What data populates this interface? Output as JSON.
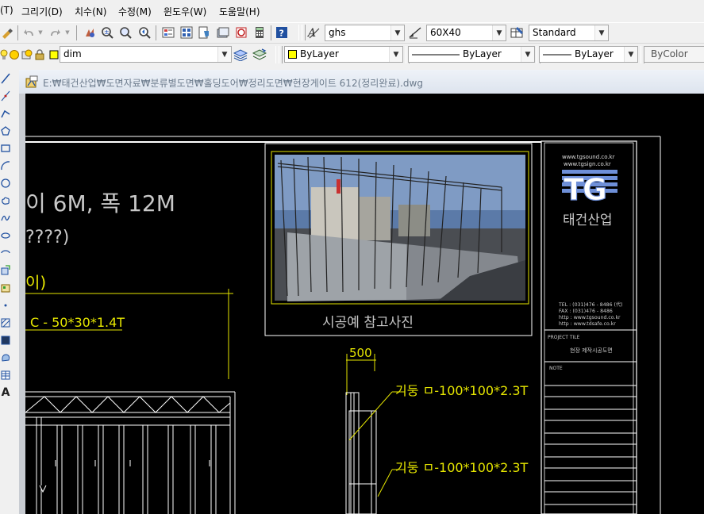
{
  "menu": {
    "items": [
      "(T)",
      "그리기(D)",
      "치수(N)",
      "수정(M)",
      "윈도우(W)",
      "도움말(H)"
    ]
  },
  "toolbar1": {
    "text_style_combo": "ghs",
    "dim_style_combo": "60X40",
    "table_style_combo": "Standard"
  },
  "toolbar2": {
    "layer_combo": "dim",
    "color_combo": "ByLayer",
    "linetype_combo": "ByLayer",
    "lineweight_combo": "ByLayer",
    "plotstyle_combo": "ByColor"
  },
  "document": {
    "title": "E:₩태건산업₩도면자료₩분류별도면₩홀딩도어₩정리도면₩현장게이트 612(정리완료).dwg"
  },
  "drawing": {
    "heading_main": "이 6M, 폭 12M",
    "heading_sub": "????)",
    "label_partial": "이)",
    "label_c_member": "C - 50*30*1.4T",
    "photo_caption": "시공예 참고사진",
    "dimension_500": "500",
    "label_post_1": "기둥  ㅁ-100*100*2.3T",
    "label_post_2": "기둥  ㅁ-100*100*2.3T",
    "title_block": {
      "web_1": "www.tgsound.co.kr",
      "web_2": "www.tgsign.co.kr",
      "logo": "TG",
      "company": "태건산업",
      "contact_1": "TEL : (031)476 - 8486 (代)",
      "contact_2": "FAX : (031)476 - 8486",
      "contact_3": "http : www.tgsound.co.kr",
      "contact_4": "http : www.tdsafe.co.kr",
      "project_title_label": "PROJECT TILE",
      "project_title_value": "현장 제작시공도면",
      "note_label": "NOTE"
    }
  },
  "colors": {
    "cad_background": "#000000",
    "cad_yellow": "#e6e600",
    "cad_white": "#ffffff",
    "cad_gray_text": "#c8c8c8",
    "logo_blue": "#6e8fd8"
  }
}
